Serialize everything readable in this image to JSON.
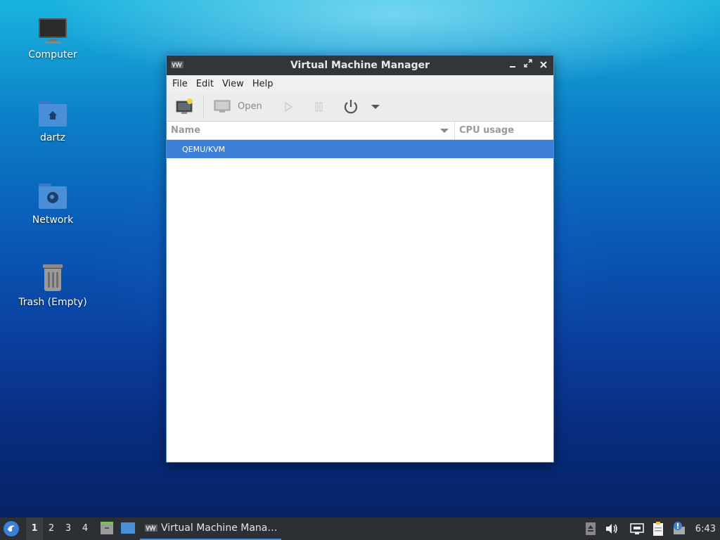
{
  "desktop": {
    "icons": [
      {
        "label": "Computer",
        "icon": "monitor-icon"
      },
      {
        "label": "dartz",
        "icon": "home-folder-icon"
      },
      {
        "label": "Network",
        "icon": "network-folder-icon"
      },
      {
        "label": "Trash (Empty)",
        "icon": "trash-icon"
      }
    ]
  },
  "window": {
    "title": "Virtual Machine Manager",
    "menu": [
      "File",
      "Edit",
      "View",
      "Help"
    ],
    "toolbar": {
      "new_vm": "new-vm-icon",
      "open_label": "Open",
      "run": "play-icon",
      "pause": "pause-icon",
      "shutdown": "power-icon",
      "more": "dropdown-arrow-icon"
    },
    "columns": {
      "name": "Name",
      "cpu": "CPU usage"
    },
    "rows": [
      {
        "name": "QEMU/KVM",
        "selected": true
      }
    ]
  },
  "taskbar": {
    "workspaces": [
      "1",
      "2",
      "3",
      "4"
    ],
    "active_workspace": "1",
    "task_label": "Virtual Machine Mana…",
    "clock": "6:43"
  },
  "colors": {
    "accent": "#3c7fd6",
    "titlebar": "#32363a",
    "taskbar": "#2c2f33"
  }
}
